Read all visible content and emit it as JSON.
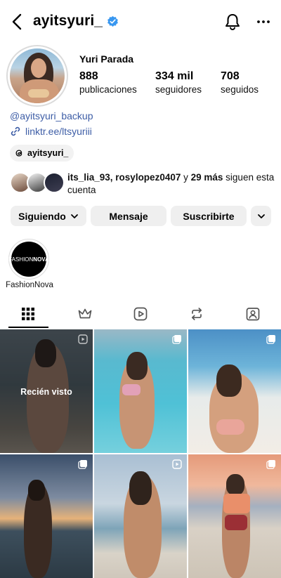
{
  "header": {
    "username": "ayitsyuri_",
    "verified": true
  },
  "profile": {
    "display_name": "Yuri Parada",
    "stats": [
      {
        "value": "888",
        "label": "publicaciones"
      },
      {
        "value": "334 mil",
        "label": "seguidores"
      },
      {
        "value": "708",
        "label": "seguidos"
      }
    ],
    "mention": "@ayitsyuri_backup",
    "link": "linktr.ee/ltsyuriii",
    "threads_handle": "ayitsyuri_"
  },
  "followed_by": {
    "names": "its_lia_93, rosylopez0407",
    "connector": " y ",
    "more": "29 más",
    "suffix": " siguen esta cuenta"
  },
  "actions": {
    "following": "Siguiendo",
    "message": "Mensaje",
    "subscribe": "Suscribirte"
  },
  "highlights": [
    {
      "label": "FashionNova",
      "cover_text_light": "FASHION",
      "cover_text_bold": "NOVA"
    }
  ],
  "tabs": [
    "grid-icon",
    "crown-icon",
    "reels-icon",
    "repost-icon",
    "tagged-icon"
  ],
  "grid": {
    "seen_label": "Recién visto"
  },
  "colors": {
    "link": "#3d5da6",
    "verified": "#3897f0",
    "button_bg": "#efefef"
  }
}
